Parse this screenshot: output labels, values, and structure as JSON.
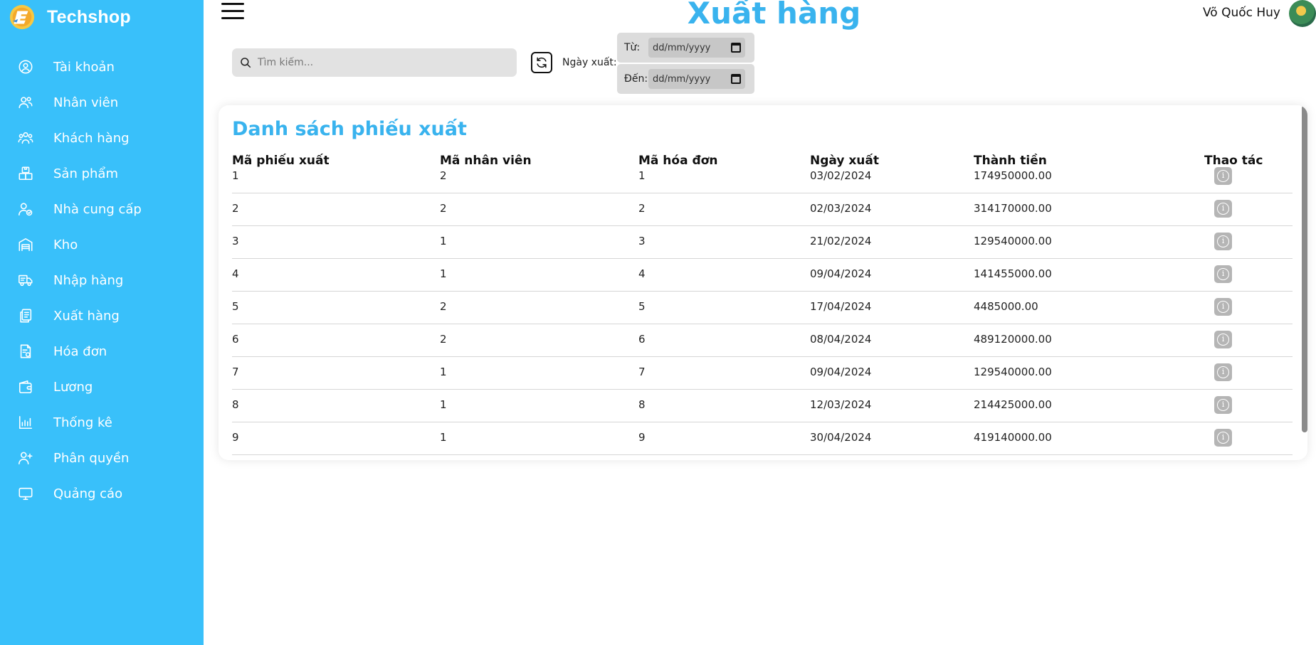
{
  "app": {
    "brand": "Techshop"
  },
  "sidebar": {
    "items": [
      {
        "label": "Tài khoản",
        "icon": "user-circle-icon"
      },
      {
        "label": "Nhân viên",
        "icon": "users-icon"
      },
      {
        "label": "Khách hàng",
        "icon": "customers-icon"
      },
      {
        "label": "Sản phẩm",
        "icon": "boxes-icon"
      },
      {
        "label": "Nhà cung cấp",
        "icon": "supplier-icon"
      },
      {
        "label": "Kho",
        "icon": "warehouse-icon"
      },
      {
        "label": "Nhập hàng",
        "icon": "truck-icon"
      },
      {
        "label": "Xuất hàng",
        "icon": "documents-icon"
      },
      {
        "label": "Hóa đơn",
        "icon": "invoice-icon"
      },
      {
        "label": "Lương",
        "icon": "wallet-icon"
      },
      {
        "label": "Thống kê",
        "icon": "chart-icon"
      },
      {
        "label": "Phân quyền",
        "icon": "user-permission-icon"
      },
      {
        "label": "Quảng cáo",
        "icon": "monitor-icon"
      }
    ]
  },
  "header": {
    "title": "Xuất hàng",
    "user_name": "Võ Quốc Huy"
  },
  "toolbar": {
    "search_placeholder": "Tìm kiếm...",
    "date_label": "Ngày xuất:",
    "from_label": "Từ:",
    "to_label": "Đến:",
    "from_value": "dd/mm/yyyy",
    "to_value": "dd/mm/yyyy"
  },
  "table": {
    "title": "Danh sách phiếu xuất",
    "columns": [
      "Mã phiếu xuất",
      "Mã nhân viên",
      "Mã hóa đơn",
      "Ngày xuất",
      "Thành tiền",
      "Thao tác"
    ],
    "rows": [
      [
        "1",
        "2",
        "1",
        "03/02/2024",
        "174950000.00"
      ],
      [
        "2",
        "2",
        "2",
        "02/03/2024",
        "314170000.00"
      ],
      [
        "3",
        "1",
        "3",
        "21/02/2024",
        "129540000.00"
      ],
      [
        "4",
        "1",
        "4",
        "09/04/2024",
        "141455000.00"
      ],
      [
        "5",
        "2",
        "5",
        "17/04/2024",
        "4485000.00"
      ],
      [
        "6",
        "2",
        "6",
        "08/04/2024",
        "489120000.00"
      ],
      [
        "7",
        "1",
        "7",
        "09/04/2024",
        "129540000.00"
      ],
      [
        "8",
        "1",
        "8",
        "12/03/2024",
        "214425000.00"
      ],
      [
        "9",
        "1",
        "9",
        "30/04/2024",
        "419140000.00"
      ]
    ],
    "action_icon": "info-icon"
  },
  "colors": {
    "sidebar": "#39c0fa",
    "accent": "#39b3ee"
  }
}
